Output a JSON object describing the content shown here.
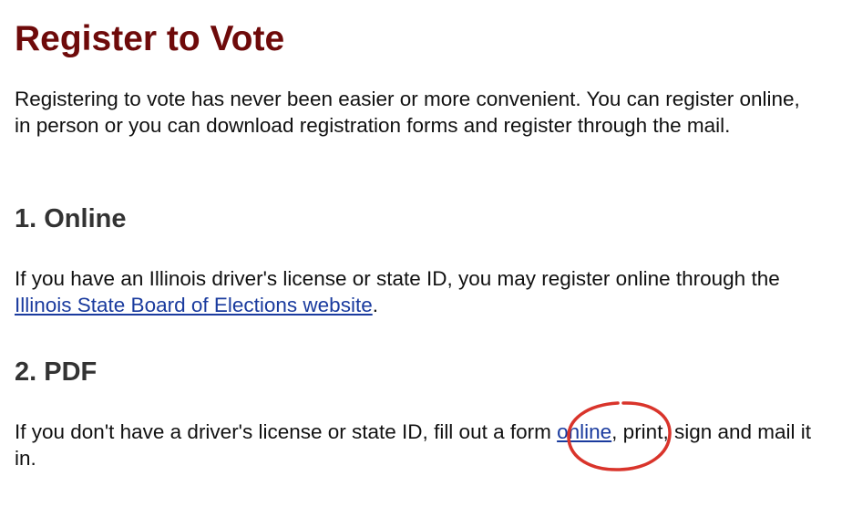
{
  "title": "Register to Vote",
  "intro": "Registering to vote has never been easier or more convenient. You can register online, in person or you can download registration forms and register through the mail.",
  "sections": [
    {
      "heading": "1. Online",
      "text_before": "If you have an Illinois driver's license or state ID, you may register online through the ",
      "link_text": "Illinois State Board of Elections website",
      "text_after": "."
    },
    {
      "heading": "2. PDF",
      "text_before": "If you don't have a driver's license or state ID, fill out a form ",
      "link_text": "online",
      "text_after": ", print, sign and mail it in."
    }
  ],
  "colors": {
    "title": "#6e0a0a",
    "heading": "#333333",
    "link": "#1a3b9e",
    "annotation": "#d9342b"
  }
}
